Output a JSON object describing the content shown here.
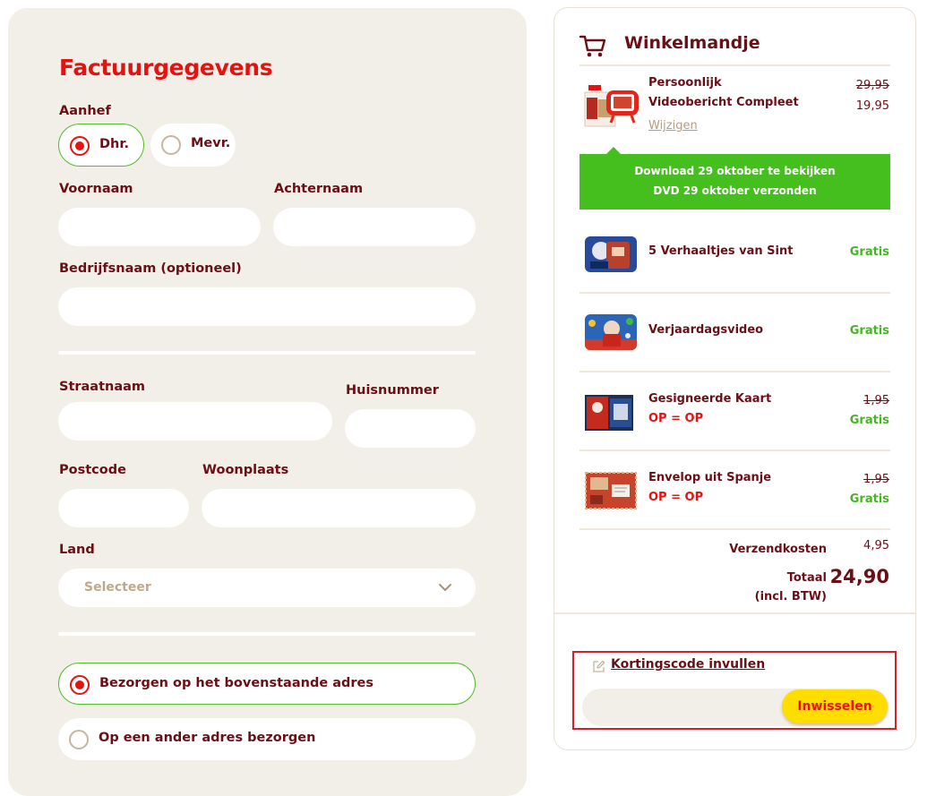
{
  "form": {
    "title": "Factuurgegevens",
    "aanhef_label": "Aanhef",
    "aanhef_options": [
      "Dhr.",
      "Mevr."
    ],
    "aanhef_selected": "Dhr.",
    "voornaam_label": "Voornaam",
    "achternaam_label": "Achternaam",
    "bedrijf_label": "Bedrijfsnaam (optioneel)",
    "straat_label": "Straatnaam",
    "huisnummer_label": "Huisnummer",
    "postcode_label": "Postcode",
    "woonplaats_label": "Woonplaats",
    "land_label": "Land",
    "land_value": "Selecteer",
    "delivery_options": [
      "Bezorgen op het bovenstaande adres",
      "Op een ander adres bezorgen"
    ],
    "delivery_selected": "Bezorgen op het bovenstaande adres"
  },
  "cart": {
    "title": "Winkelmandje",
    "items": [
      {
        "name": "Persoonlijk Videobericht Compleet",
        "old_price": "29,95",
        "price": "19,95",
        "edit": "Wijzigen"
      },
      {
        "name": "5 Verhaaltjes van Sint",
        "price": "Gratis"
      },
      {
        "name": "Verjaardagsvideo",
        "price": "Gratis"
      },
      {
        "name": "Gesigneerde Kaart",
        "tag": "OP = OP",
        "old_price": "1,95",
        "price": "Gratis"
      },
      {
        "name": "Envelop uit Spanje",
        "tag": "OP = OP",
        "old_price": "1,95",
        "price": "Gratis"
      }
    ],
    "banner_line1": "Download 29 oktober te bekijken",
    "banner_line2": "DVD 29 oktober verzonden",
    "shipping_label": "Verzendkosten",
    "shipping_value": "4,95",
    "total_label_1": "Totaal",
    "total_label_2": "(incl. BTW)",
    "total_value": "24,90",
    "coupon_link": "Kortingscode invullen",
    "coupon_button": "Inwisselen"
  },
  "colors": {
    "accent_red": "#e5120f",
    "text_maroon": "#6b0f16",
    "green": "#45bf1e",
    "yellow_button": "#ffdd00",
    "form_panel_bg": "#f2eee8"
  },
  "icons": {
    "cart": "cart-icon",
    "edit": "pencil-icon",
    "select": "chevron-down-icon"
  }
}
